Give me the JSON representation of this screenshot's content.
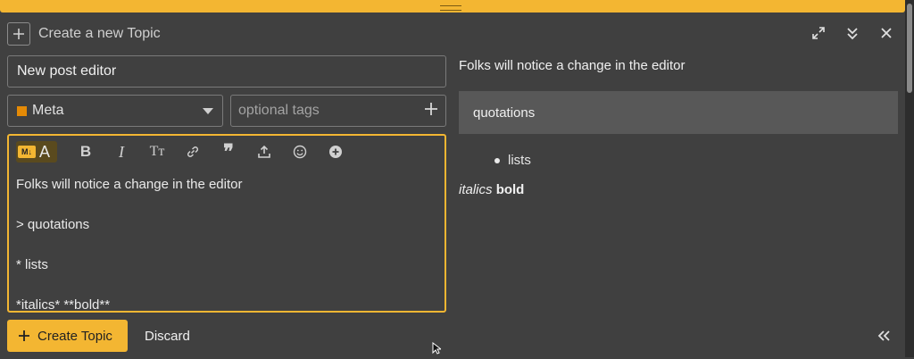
{
  "header": {
    "title": "Create a new Topic",
    "icons": [
      "plus-icon",
      "expand-icon",
      "minimize-icon",
      "close-icon"
    ]
  },
  "composer": {
    "title_value": "New post editor",
    "category": {
      "label": "Meta",
      "color": "#e48a06"
    },
    "tags_placeholder": "optional tags",
    "toolbar_icons": [
      "markdown-toggle",
      "bold-icon",
      "italic-icon",
      "heading-icon",
      "link-icon",
      "quote-icon",
      "upload-icon",
      "emoji-icon",
      "add-icon"
    ],
    "toolbar_md_badge": "M↓",
    "toolbar_md_letter": "A",
    "toolbar_bold_glyph": "B",
    "toolbar_italic_glyph": "I",
    "toolbar_heading_glyph": "Tт",
    "toolbar_quote_glyph": "❞",
    "editor_lines": [
      "Folks will notice a change in the editor",
      "",
      "> quotations",
      "",
      "* lists",
      "",
      "*italics* **bold**"
    ]
  },
  "preview": {
    "paragraph": "Folks will notice a change in the editor",
    "blockquote": "quotations",
    "list_item": "lists",
    "italic_text": "italics",
    "bold_text": "bold"
  },
  "footer": {
    "create_label": "Create Topic",
    "discard_label": "Discard"
  },
  "colors": {
    "accent": "#f3b632",
    "background": "#404040"
  }
}
